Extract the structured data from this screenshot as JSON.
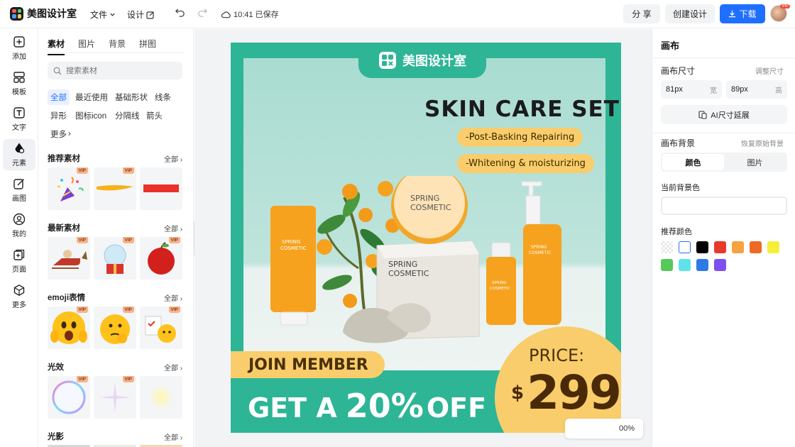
{
  "topbar": {
    "app_name": "美图设计室",
    "menu_file": "文件",
    "menu_design": "设计",
    "save_status": "10:41 已保存",
    "share_label": "分 享",
    "create_label": "创建设计",
    "download_label": "下载",
    "avatar_badge": "VIP"
  },
  "leftnav": {
    "items": [
      {
        "label": "添加",
        "icon": "plus-square-icon"
      },
      {
        "label": "模板",
        "icon": "template-grid-icon"
      },
      {
        "label": "文字",
        "icon": "text-icon"
      },
      {
        "label": "元素",
        "icon": "shapes-icon"
      },
      {
        "label": "画图",
        "icon": "draw-icon"
      },
      {
        "label": "我的",
        "icon": "user-icon"
      },
      {
        "label": "页面",
        "icon": "page-add-icon"
      },
      {
        "label": "更多",
        "icon": "cube-icon"
      }
    ]
  },
  "panel": {
    "tabs": [
      "素材",
      "图片",
      "背景",
      "拼图"
    ],
    "search_placeholder": "搜索素材",
    "chips": [
      "全部",
      "最近使用",
      "基础形状",
      "线条",
      "异形",
      "图标icon",
      "分隔线",
      "箭头",
      "更多"
    ],
    "sections": [
      {
        "title": "推荐素材",
        "all": "全部"
      },
      {
        "title": "最新素材",
        "all": "全部"
      },
      {
        "title": "emoji表情",
        "all": "全部"
      },
      {
        "title": "光效",
        "all": "全部"
      },
      {
        "title": "光影",
        "all": "全部"
      }
    ],
    "vip_label": "VIP"
  },
  "design": {
    "brand": "美图设计室",
    "headline": "SKIN CARE SET",
    "pill1": "-Post-Basking Repairing",
    "pill2": "-Whitening & moisturizing",
    "product_text": "SPRING COSMETIC",
    "join": "JOIN MEMBER",
    "offer_a": "GET A",
    "offer_pct": "20%",
    "offer_off": "OFF",
    "price_label": "PRICE:",
    "currency": "$",
    "price": "299"
  },
  "zoom": {
    "value": "00%"
  },
  "rpanel": {
    "title": "画布",
    "size_label": "画布尺寸",
    "adjust_size": "调整尺寸",
    "width_value": "81px",
    "width_unit": "宽",
    "height_value": "89px",
    "height_unit": "高",
    "ai_extend": "AI尺寸延展",
    "bg_label": "画布背景",
    "reset_bg": "恢复原始背景",
    "seg_color": "颜色",
    "seg_image": "图片",
    "current_bg": "当前背景色",
    "recommend": "推荐颜色",
    "swatches": [
      "transparent",
      "#ffffff",
      "#000000",
      "#e8392a",
      "#f4a340",
      "#ee6a24",
      "#f6ef3a",
      "#55c95a",
      "#5fe3e8",
      "#2d7ae6",
      "#7f4ef0"
    ]
  }
}
